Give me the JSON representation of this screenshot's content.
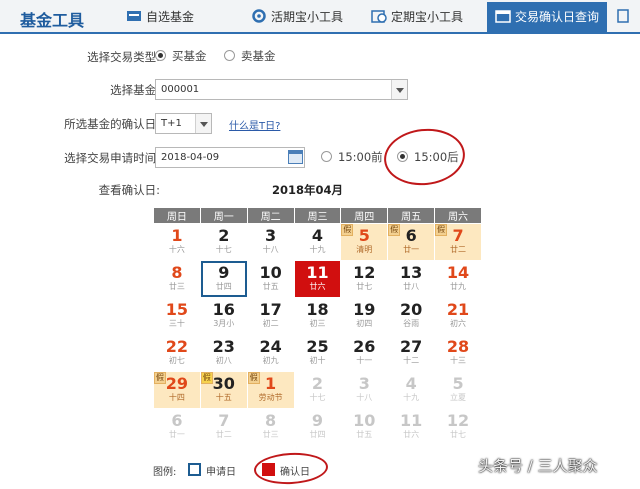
{
  "header": {
    "title": "基金工具",
    "tabs": [
      {
        "label": "自选基金",
        "icon": "fund-icon"
      },
      {
        "label": "活期宝小工具",
        "icon": "gear-icon"
      },
      {
        "label": "定期宝小工具",
        "icon": "calendar-clock-icon"
      },
      {
        "label": "交易确认日查询",
        "icon": "calendar-icon"
      }
    ]
  },
  "form": {
    "trade_type_label": "选择交易类型:",
    "trade_options": [
      {
        "label": "买基金",
        "checked": true
      },
      {
        "label": "卖基金",
        "checked": false
      }
    ],
    "fund_label": "选择基金:",
    "fund_value": "000001",
    "confirm_label": "所选基金的确认日:",
    "confirm_value": "T+1",
    "what_is_t_link": "什么是T日?",
    "time_label": "选择交易申请时间:",
    "date_value": "2018-04-09",
    "time_options": [
      {
        "label": "15:00前",
        "checked": false
      },
      {
        "label": "15:00后",
        "checked": true
      }
    ],
    "view_label": "查看确认日:"
  },
  "calendar": {
    "title": "2018年04月",
    "weekdays": [
      "周日",
      "周一",
      "周二",
      "周三",
      "周四",
      "周五",
      "周六"
    ],
    "rows": [
      [
        {
          "d": "1",
          "l": "十六",
          "cls": "wk"
        },
        {
          "d": "2",
          "l": "十七",
          "cls": ""
        },
        {
          "d": "3",
          "l": "十八",
          "cls": ""
        },
        {
          "d": "4",
          "l": "十九",
          "cls": ""
        },
        {
          "d": "5",
          "l": "清明",
          "cls": "hol",
          "tag": "假"
        },
        {
          "d": "6",
          "l": "廿一",
          "cls": "hol dark",
          "tag": "假"
        },
        {
          "d": "7",
          "l": "廿二",
          "cls": "hol",
          "tag": "假"
        }
      ],
      [
        {
          "d": "8",
          "l": "廿三",
          "cls": "wk"
        },
        {
          "d": "9",
          "l": "廿四",
          "cls": "apply"
        },
        {
          "d": "10",
          "l": "廿五",
          "cls": ""
        },
        {
          "d": "11",
          "l": "廿六",
          "cls": "today"
        },
        {
          "d": "12",
          "l": "廿七",
          "cls": ""
        },
        {
          "d": "13",
          "l": "廿八",
          "cls": ""
        },
        {
          "d": "14",
          "l": "廿九",
          "cls": "wk"
        }
      ],
      [
        {
          "d": "15",
          "l": "三十",
          "cls": "wk"
        },
        {
          "d": "16",
          "l": "3月小",
          "cls": ""
        },
        {
          "d": "17",
          "l": "初二",
          "cls": ""
        },
        {
          "d": "18",
          "l": "初三",
          "cls": ""
        },
        {
          "d": "19",
          "l": "初四",
          "cls": ""
        },
        {
          "d": "20",
          "l": "谷雨",
          "cls": ""
        },
        {
          "d": "21",
          "l": "初六",
          "cls": "wk"
        }
      ],
      [
        {
          "d": "22",
          "l": "初七",
          "cls": "wk"
        },
        {
          "d": "23",
          "l": "初八",
          "cls": ""
        },
        {
          "d": "24",
          "l": "初九",
          "cls": ""
        },
        {
          "d": "25",
          "l": "初十",
          "cls": ""
        },
        {
          "d": "26",
          "l": "十一",
          "cls": ""
        },
        {
          "d": "27",
          "l": "十二",
          "cls": ""
        },
        {
          "d": "28",
          "l": "十三",
          "cls": "wk"
        }
      ],
      [
        {
          "d": "29",
          "l": "十四",
          "cls": "hol",
          "tag": "假"
        },
        {
          "d": "30",
          "l": "十五",
          "cls": "hol dark",
          "tag": "假",
          "tagcls": "work"
        },
        {
          "d": "1",
          "l": "劳动节",
          "cls": "hol",
          "tag": "假"
        },
        {
          "d": "2",
          "l": "十七",
          "cls": "oth"
        },
        {
          "d": "3",
          "l": "十八",
          "cls": "oth"
        },
        {
          "d": "4",
          "l": "十九",
          "cls": "oth"
        },
        {
          "d": "5",
          "l": "立夏",
          "cls": "oth"
        }
      ],
      [
        {
          "d": "6",
          "l": "廿一",
          "cls": "oth"
        },
        {
          "d": "7",
          "l": "廿二",
          "cls": "oth"
        },
        {
          "d": "8",
          "l": "廿三",
          "cls": "oth"
        },
        {
          "d": "9",
          "l": "廿四",
          "cls": "oth"
        },
        {
          "d": "10",
          "l": "廿五",
          "cls": "oth"
        },
        {
          "d": "11",
          "l": "廿六",
          "cls": "oth"
        },
        {
          "d": "12",
          "l": "廿七",
          "cls": "oth"
        }
      ]
    ]
  },
  "legend": {
    "label": "图例:",
    "apply": "申请日",
    "confirm": "确认日",
    "apply_color": "#1d5c91",
    "confirm_color": "#d10f0f"
  },
  "watermark": "头条号 / 三人聚众"
}
